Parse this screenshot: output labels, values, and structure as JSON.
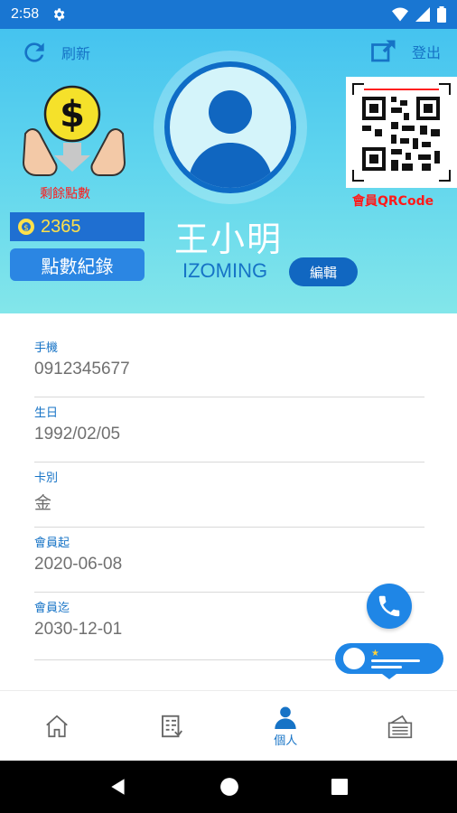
{
  "status_bar": {
    "time": "2:58"
  },
  "header": {
    "refresh_label": "刷新",
    "logout_label": "登出",
    "remaining_points_label": "剩餘點數",
    "points_value": "2365",
    "points_record_label": "點數紀錄",
    "qr_label": "會員QRCode"
  },
  "profile": {
    "name": "王小明",
    "username": "IZOMING",
    "edit_label": "編輯"
  },
  "fields": [
    {
      "label": "手機",
      "value": "0912345677"
    },
    {
      "label": "生日",
      "value": "1992/02/05"
    },
    {
      "label": "卡別",
      "value": "金"
    },
    {
      "label": "會員起",
      "value": "2020-06-08"
    },
    {
      "label": "會員迄",
      "value": "2030-12-01"
    }
  ],
  "bottom_nav": {
    "active_label": "個人"
  },
  "colors": {
    "primary": "#1673c6",
    "status_bar": "#1976d2",
    "header_gradient_top": "#45c3ef",
    "header_gradient_bottom": "#83e6ea",
    "accent_red": "#ff1a1a",
    "points_text": "#ffe14a"
  },
  "icons": [
    "gear-icon",
    "wifi-icon",
    "signal-icon",
    "battery-icon",
    "refresh-icon",
    "logout-icon",
    "coin-hands-icon",
    "coin-icon",
    "avatar-icon",
    "qr-code-icon",
    "phone-icon",
    "chat-icon",
    "home-icon",
    "list-icon",
    "person-icon",
    "wallet-icon",
    "back-icon",
    "home-circle-icon",
    "recents-icon"
  ]
}
